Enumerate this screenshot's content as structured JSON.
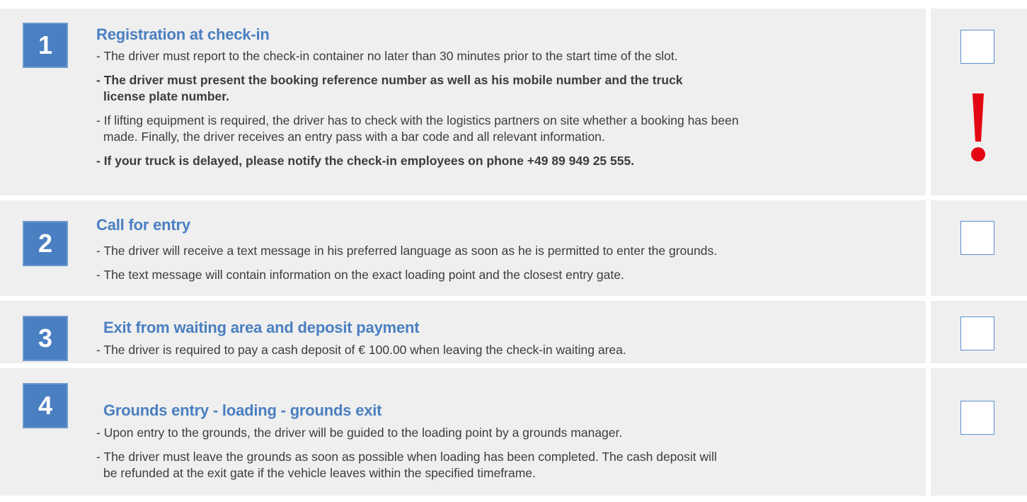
{
  "steps": [
    {
      "number": "1",
      "title": "Registration at check-in",
      "lines": [
        "- The driver must report to the check-in container no later than 30 minutes prior to the start time of the slot.",
        "- The driver must present the booking reference number as well as his mobile number and the truck",
        "license plate number.",
        "- If lifting equipment is required, the driver has to check with the logistics partners on site whether a booking has been",
        "made. Finally, the driver receives an entry pass with a bar code and all relevant information.",
        "- If your truck is delayed, please notify the check-in employees on phone +49 89 949 25 555."
      ],
      "warning": "!"
    },
    {
      "number": "2",
      "title": "Call for entry",
      "lines": [
        "- The driver will receive a text message in his preferred language as soon as he is permitted to enter the grounds.",
        "- The text message will contain information on the exact loading point and the closest entry gate."
      ]
    },
    {
      "number": "3",
      "title": "Exit from waiting area and deposit payment",
      "lines": [
        "- The driver is required to pay a cash deposit of € 100.00 when leaving the check-in waiting area."
      ]
    },
    {
      "number": "4",
      "title": "Grounds entry - loading - grounds exit",
      "lines": [
        "- Upon entry to the grounds, the driver will be guided to the loading point by a grounds manager.",
        "- The driver must leave the grounds as soon as possible when loading has been completed. The cash deposit will",
        "be refunded at the exit gate if the vehicle leaves within the specified timeframe."
      ]
    }
  ],
  "colors": {
    "accent": "#4a7fc1",
    "warning": "#e30613",
    "row_bg": "#efefef",
    "text": "#3c3c3c"
  },
  "icons": {
    "warning": "exclamation-mark-icon",
    "checkbox": "empty-checkbox"
  }
}
